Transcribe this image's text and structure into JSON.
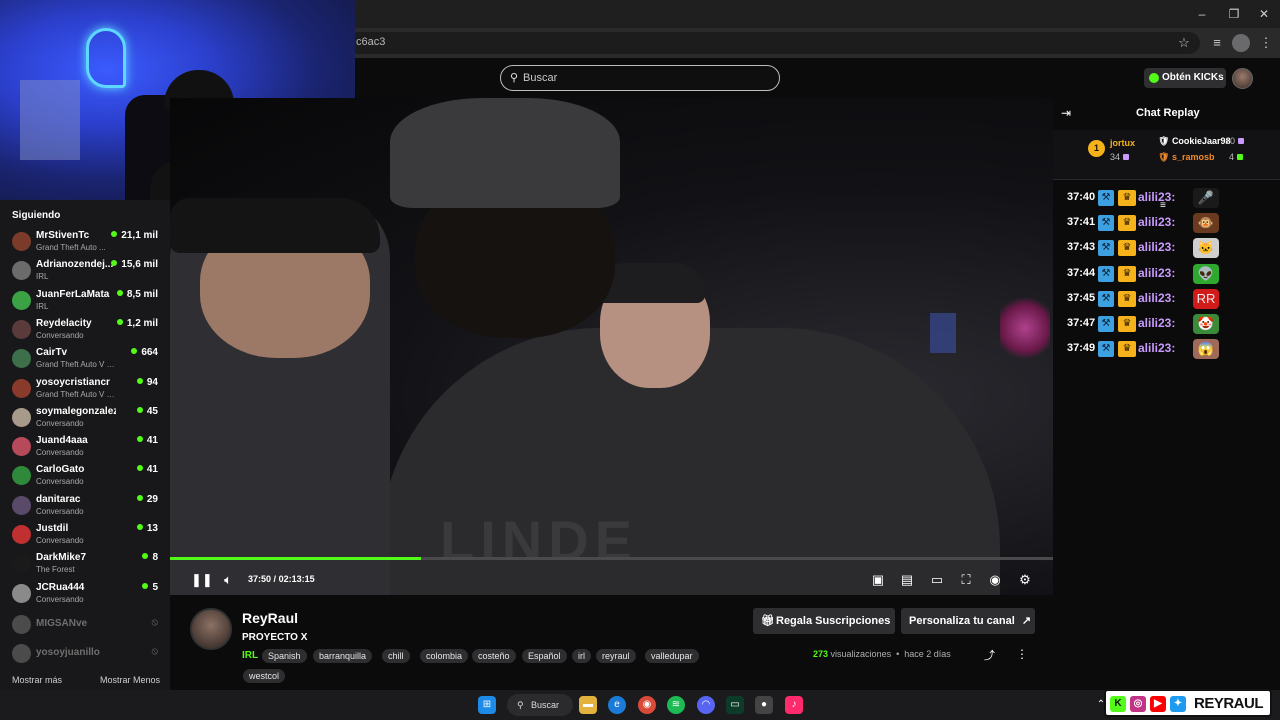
{
  "browser": {
    "url_fragment": "c6ac3",
    "window_controls": [
      "–",
      "❐",
      "✕"
    ]
  },
  "header": {
    "search_placeholder": "Buscar",
    "kicks_button": "Obtén KICKs"
  },
  "sidebar": {
    "title": "Siguiendo",
    "items": [
      {
        "name": "MrStivenTc",
        "sub": "Grand Theft Auto ...",
        "count": "21,1 mil",
        "color": "#7a3b2a"
      },
      {
        "name": "Adrianozendej...",
        "sub": "IRL",
        "count": "15,6 mil",
        "color": "#6b6b6b"
      },
      {
        "name": "JuanFerLaMata",
        "sub": "IRL",
        "count": "8,5 mil",
        "color": "#3aa245"
      },
      {
        "name": "Reydelacity",
        "sub": "Conversando",
        "count": "1,2 mil",
        "color": "#5a3a3a"
      },
      {
        "name": "CairTv",
        "sub": "Grand Theft Auto V (G...",
        "count": "664",
        "color": "#3c6f4a"
      },
      {
        "name": "yosoycristiancr",
        "sub": "Grand Theft Auto V (GTA)",
        "count": "94",
        "color": "#8a3a2a"
      },
      {
        "name": "soymalegonzalez",
        "sub": "Conversando",
        "count": "45",
        "color": "#a89a8a"
      },
      {
        "name": "Juand4aaa",
        "sub": "Conversando",
        "count": "41",
        "color": "#b74a5a"
      },
      {
        "name": "CarloGato",
        "sub": "Conversando",
        "count": "41",
        "color": "#2e8a3a"
      },
      {
        "name": "danitarac",
        "sub": "Conversando",
        "count": "29",
        "color": "#5a4a6a"
      },
      {
        "name": "Justdil",
        "sub": "Conversando",
        "count": "13",
        "color": "#c03030"
      },
      {
        "name": "DarkMike7",
        "sub": "The Forest",
        "count": "8",
        "color": "#1a1a1a"
      },
      {
        "name": "JCRua444",
        "sub": "Conversando",
        "count": "5",
        "color": "#8a8a8a"
      }
    ],
    "offline": [
      {
        "name": "MIGSANve",
        "color": "#8a8a8a"
      },
      {
        "name": "yosoyjuanillo",
        "color": "#8a8a8a"
      }
    ],
    "show_more": "Mostrar más",
    "show_less": "Mostrar Menos"
  },
  "player": {
    "current_time": "37:50",
    "separator": "/",
    "duration": "02:13:15",
    "progress_fraction": 0.284,
    "shirt_text": "LINDE"
  },
  "channel": {
    "name": "ReyRaul",
    "title": "PROYECTO X",
    "category": "IRL",
    "tags": [
      "Spanish",
      "barranquilla",
      "chill",
      "colombia",
      "costeño",
      "Español",
      "irl",
      "reyraul",
      "valledupar",
      "westcol"
    ],
    "gift_button": "Regala Suscripciones",
    "customize_button": "Personaliza tu canal",
    "views_count": "273",
    "views_label": "visualizaciones",
    "age": "hace 2 días"
  },
  "chat": {
    "title": "Chat Replay",
    "top_gifter": {
      "rank": "1",
      "name": "jortux",
      "count": "34"
    },
    "gifter2": {
      "name": "CookieJaar98",
      "count": "10"
    },
    "gifter3": {
      "name": "s_ramosb",
      "count": "4"
    },
    "messages": [
      {
        "time": "37:40",
        "user": "alili23:",
        "emote": "🎤",
        "emote_bg": "#1a1a1a"
      },
      {
        "time": "37:41",
        "user": "alili23:",
        "emote": "🐵",
        "emote_bg": "#6a3a20"
      },
      {
        "time": "37:43",
        "user": "alili23:",
        "emote": "🐱",
        "emote_bg": "#cfcfcf"
      },
      {
        "time": "37:44",
        "user": "alili23:",
        "emote": "👽",
        "emote_bg": "#2fa82f"
      },
      {
        "time": "37:45",
        "user": "alili23:",
        "emote": "RR",
        "emote_bg": "#d11a1a"
      },
      {
        "time": "37:47",
        "user": "alili23:",
        "emote": "🤡",
        "emote_bg": "#3a8a3a"
      },
      {
        "time": "37:49",
        "user": "alili23:",
        "emote": "😱",
        "emote_bg": "#a06a5a"
      }
    ]
  },
  "taskbar": {
    "search_label": "Buscar",
    "brand_text": "REYRAUL"
  },
  "colors": {
    "accent": "#53fc18",
    "chat_user": "#c99bff",
    "gold": "#f5b21b"
  }
}
